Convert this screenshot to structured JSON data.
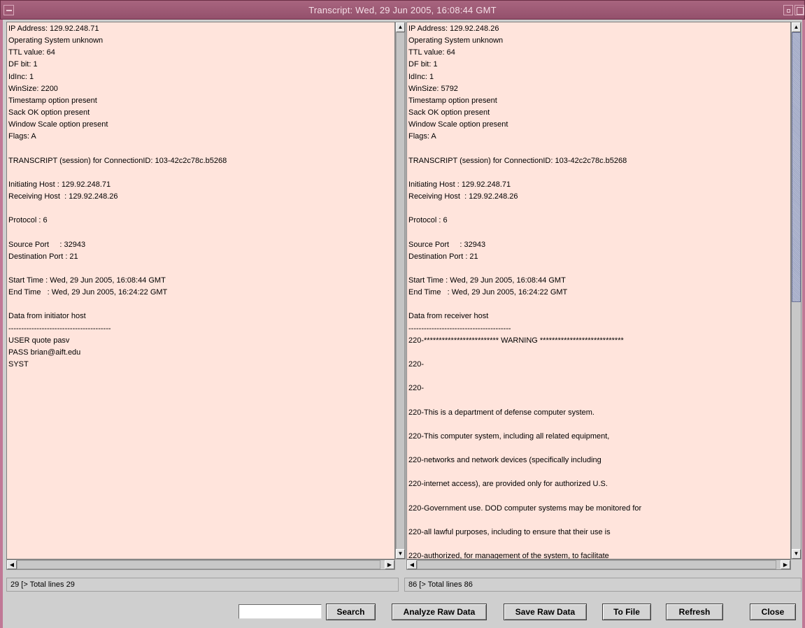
{
  "window": {
    "title": "Transcript:  Wed, 29 Jun 2005, 16:08:44 GMT"
  },
  "left_pane": {
    "lines": [
      "IP Address: 129.92.248.71",
      "Operating System unknown",
      "TTL value: 64",
      "DF bit: 1",
      "IdInc: 1",
      "WinSize: 2200",
      "Timestamp option present",
      "Sack OK option present",
      "Window Scale option present",
      "Flags: A",
      "",
      "TRANSCRIPT (session) for ConnectionID: 103-42c2c78c.b5268",
      "",
      "Initiating Host : 129.92.248.71",
      "Receiving Host  : 129.92.248.26",
      "",
      "Protocol : 6",
      "",
      "Source Port     : 32943",
      "Destination Port : 21",
      "",
      "Start Time : Wed, 29 Jun 2005, 16:08:44 GMT",
      "End Time   : Wed, 29 Jun 2005, 16:24:22 GMT",
      "",
      "Data from initiator host",
      "----------------------------------------",
      "USER quote pasv",
      "PASS brian@aift.edu",
      "SYST"
    ],
    "status": "29 [> Total lines 29"
  },
  "right_pane": {
    "lines": [
      "IP Address: 129.92.248.26",
      "Operating System unknown",
      "TTL value: 64",
      "DF bit: 1",
      "IdInc: 1",
      "WinSize: 5792",
      "Timestamp option present",
      "Sack OK option present",
      "Window Scale option present",
      "Flags: A",
      "",
      "TRANSCRIPT (session) for ConnectionID: 103-42c2c78c.b5268",
      "",
      "Initiating Host : 129.92.248.71",
      "Receiving Host  : 129.92.248.26",
      "",
      "Protocol : 6",
      "",
      "Source Port     : 32943",
      "Destination Port : 21",
      "",
      "Start Time : Wed, 29 Jun 2005, 16:08:44 GMT",
      "End Time   : Wed, 29 Jun 2005, 16:24:22 GMT",
      "",
      "Data from receiver host",
      "----------------------------------------",
      "220-************************* WARNING ****************************",
      "",
      "220-",
      "",
      "220-",
      "",
      "220-This is a department of defense computer system.",
      "",
      "220-This computer system, including all related equipment,",
      "",
      "220-networks and network devices (specifically including",
      "",
      "220-internet access), are provided only for authorized U.S.",
      "",
      "220-Government use. DOD computer systems may be monitored for",
      "",
      "220-all lawful purposes, including to ensure that their use is",
      "",
      "220-authorized, for management of the system, to facilitate"
    ],
    "status": "86 [> Total lines 86"
  },
  "toolbar": {
    "search_value": "",
    "search_label": "Search",
    "analyze_label": "Analyze Raw Data",
    "save_label": "Save Raw Data",
    "tofile_label": "To File",
    "refresh_label": "Refresh",
    "close_label": "Close"
  },
  "colors": {
    "titlebar": "#9c5874",
    "pane_background": "#ffe4dc",
    "window_background": "#cfcfcf"
  },
  "icons": {
    "system_menu": "window-menu-icon",
    "minimize": "minimize-icon",
    "maximize": "maximize-icon",
    "scroll_up": "arrow-up-icon",
    "scroll_down": "arrow-down-icon",
    "scroll_left": "arrow-left-icon",
    "scroll_right": "arrow-right-icon"
  }
}
